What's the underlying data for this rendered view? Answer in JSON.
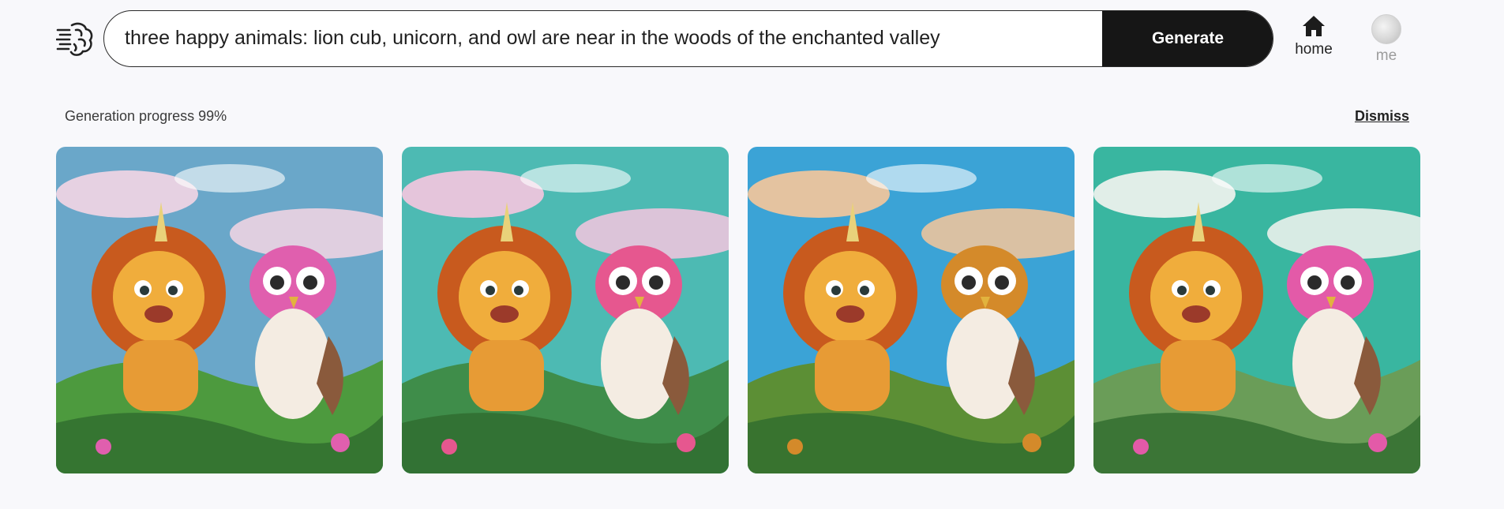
{
  "prompt": {
    "value": "three happy animals: lion cub, unicorn, and owl are near in the woods of the enchanted valley"
  },
  "toolbar": {
    "generate_label": "Generate"
  },
  "nav": {
    "home_label": "home",
    "me_label": "me"
  },
  "status": {
    "progress_text": "Generation progress 99%",
    "progress_value": 99,
    "dismiss_label": "Dismiss"
  },
  "gallery": {
    "images": [
      {
        "sky": "#6aa7c9",
        "cloud": "#f4d6e4",
        "ground": "#4d9a3e",
        "accent": "#e05fae"
      },
      {
        "sky": "#4dbab3",
        "cloud": "#f6c6df",
        "ground": "#3f8d4a",
        "accent": "#e6578f"
      },
      {
        "sky": "#3ba3d6",
        "cloud": "#f7c79a",
        "ground": "#5c8f35",
        "accent": "#d48a2a"
      },
      {
        "sky": "#39b6a0",
        "cloud": "#f4f4f0",
        "ground": "#6a9d58",
        "accent": "#e35aa8"
      }
    ]
  }
}
